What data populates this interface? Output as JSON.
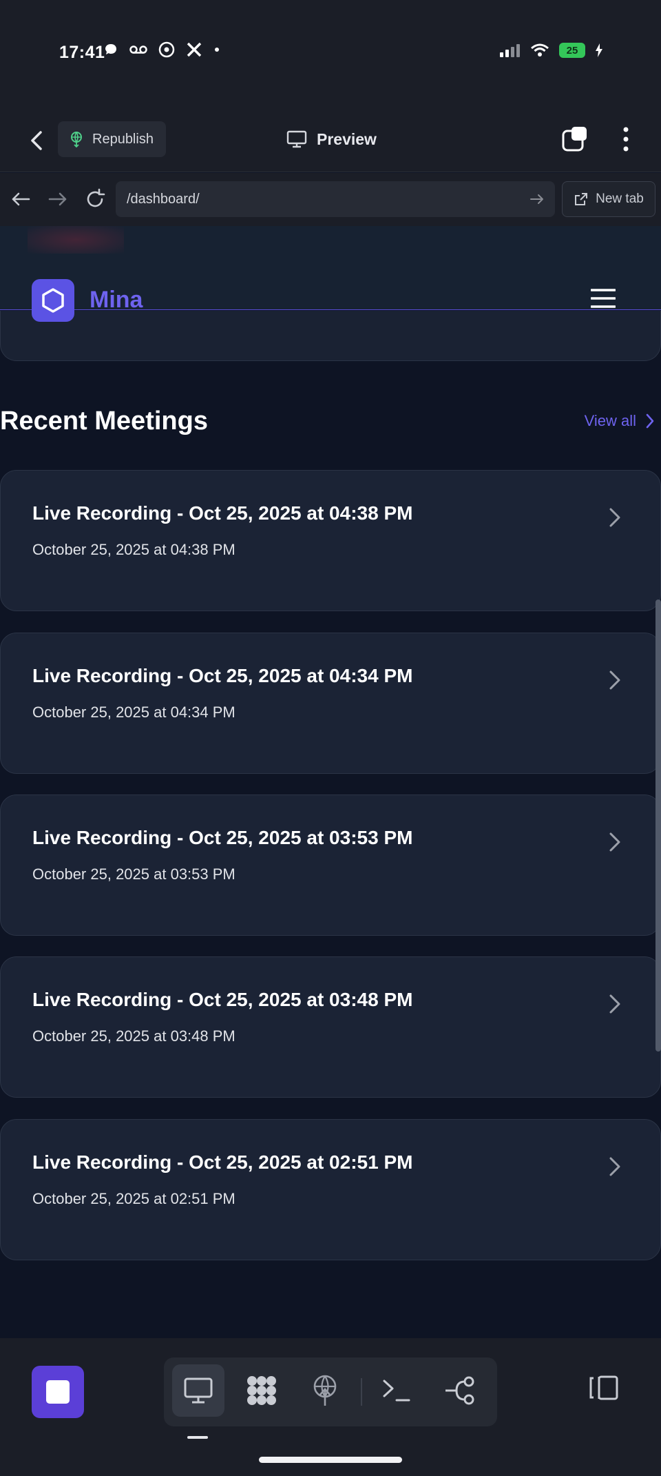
{
  "status_bar": {
    "time": "17:41",
    "battery": "25"
  },
  "topbar": {
    "republish_label": "Republish",
    "preview_label": "Preview"
  },
  "urlbar": {
    "url": "/dashboard/",
    "new_tab_label": "New tab"
  },
  "site": {
    "logo_text": "Mina"
  },
  "recent_meetings": {
    "title": "Recent Meetings",
    "view_all_label": "View all",
    "items": [
      {
        "title": "Live Recording - Oct 25, 2025 at 04:38 PM",
        "date": "October 25, 2025 at 04:38 PM"
      },
      {
        "title": "Live Recording - Oct 25, 2025 at 04:34 PM",
        "date": "October 25, 2025 at 04:34 PM"
      },
      {
        "title": "Live Recording - Oct 25, 2025 at 03:53 PM",
        "date": "October 25, 2025 at 03:53 PM"
      },
      {
        "title": "Live Recording - Oct 25, 2025 at 03:48 PM",
        "date": "October 25, 2025 at 03:48 PM"
      },
      {
        "title": "Live Recording - Oct 25, 2025 at 02:51 PM",
        "date": "October 25, 2025 at 02:51 PM"
      }
    ]
  },
  "bottom_toolbar": {
    "tools": [
      "monitor-icon",
      "apps-icon",
      "deploy-icon",
      "terminal-icon",
      "git-branch-icon"
    ],
    "active_tool": "monitor-icon"
  },
  "colors": {
    "accent": "#6e63ef",
    "logo_bg": "#5b53e4",
    "card_bg": "#1b2335",
    "page_bg": "#0e1424"
  }
}
